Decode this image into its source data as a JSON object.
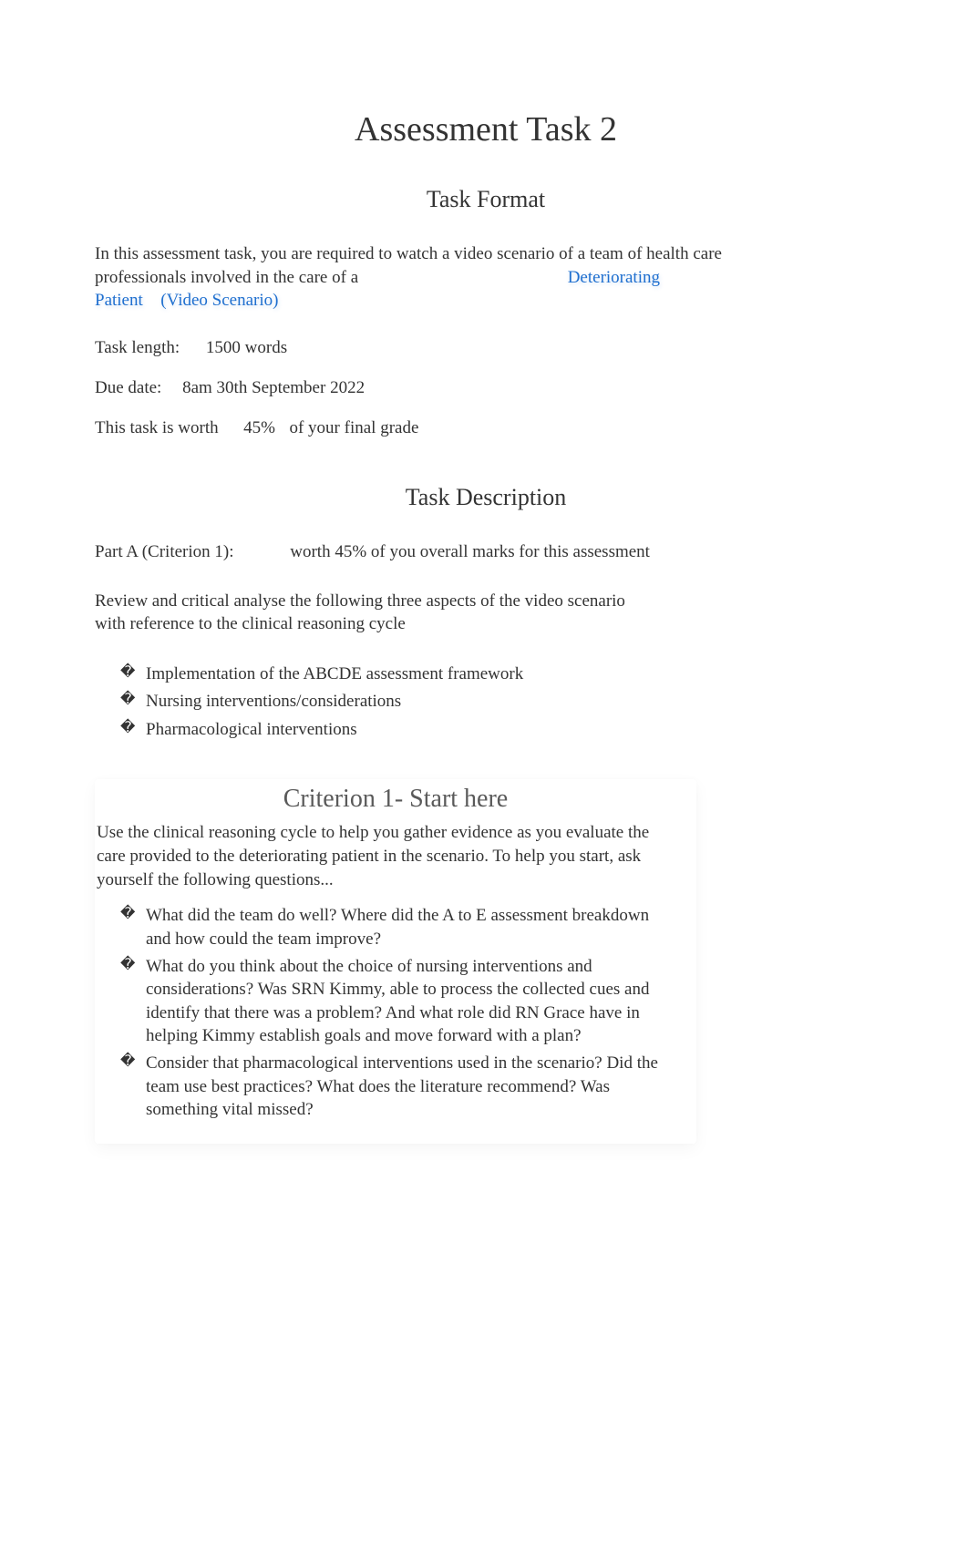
{
  "title": "Assessment Task 2",
  "taskFormat": {
    "heading": "Task Format",
    "intro_prefix": "In this assessment task, you are required to watch a video scenario of a team of health care professionals involved in the care of a ",
    "link_deteriorating": "Deteriorating",
    "link_patient": "Patient",
    "link_video": "(Video Scenario)",
    "taskLengthLabel": "Task length:",
    "taskLengthValue": "1500 words",
    "dueDateLabel": "Due date:",
    "dueDateValue": "8am 30th September 2022",
    "weightPrefix": "This task is worth ",
    "weightValue": "45%",
    "weightSuffix": " of your final grade"
  },
  "taskDescription": {
    "heading": "Task Description",
    "partA_line": "Part A (Criterion 1):             worth 45% of you overall marks for this assessment",
    "reviewLine": "Review and critical analyse the following three aspects of the video scenario with reference to the clinical reasoning cycle",
    "bullets": [
      "Implementation of the ABCDE assessment framework",
      "Nursing interventions/considerations",
      "Pharmacological interventions"
    ]
  },
  "criterion1": {
    "heading": "Criterion 1- Start here",
    "intro": " Use the clinical reasoning cycle to help you gather evidence as you evaluate the care provided to the deteriorating patient in the scenario. To help you start, ask yourself the following questions...",
    "bullets": [
      "What did the team do well? Where did the A to E assessment breakdown and how could the team improve?",
      "What do you think about the choice of nursing interventions and considerations? Was SRN Kimmy, able to process the collected cues and identify that there was a problem? And what role did RN Grace have in helping Kimmy establish goals and move forward with a plan?",
      "Consider that pharmacological interventions used in the scenario? Did the team use best practices? What does the literature recommend? Was something vital missed?"
    ]
  }
}
